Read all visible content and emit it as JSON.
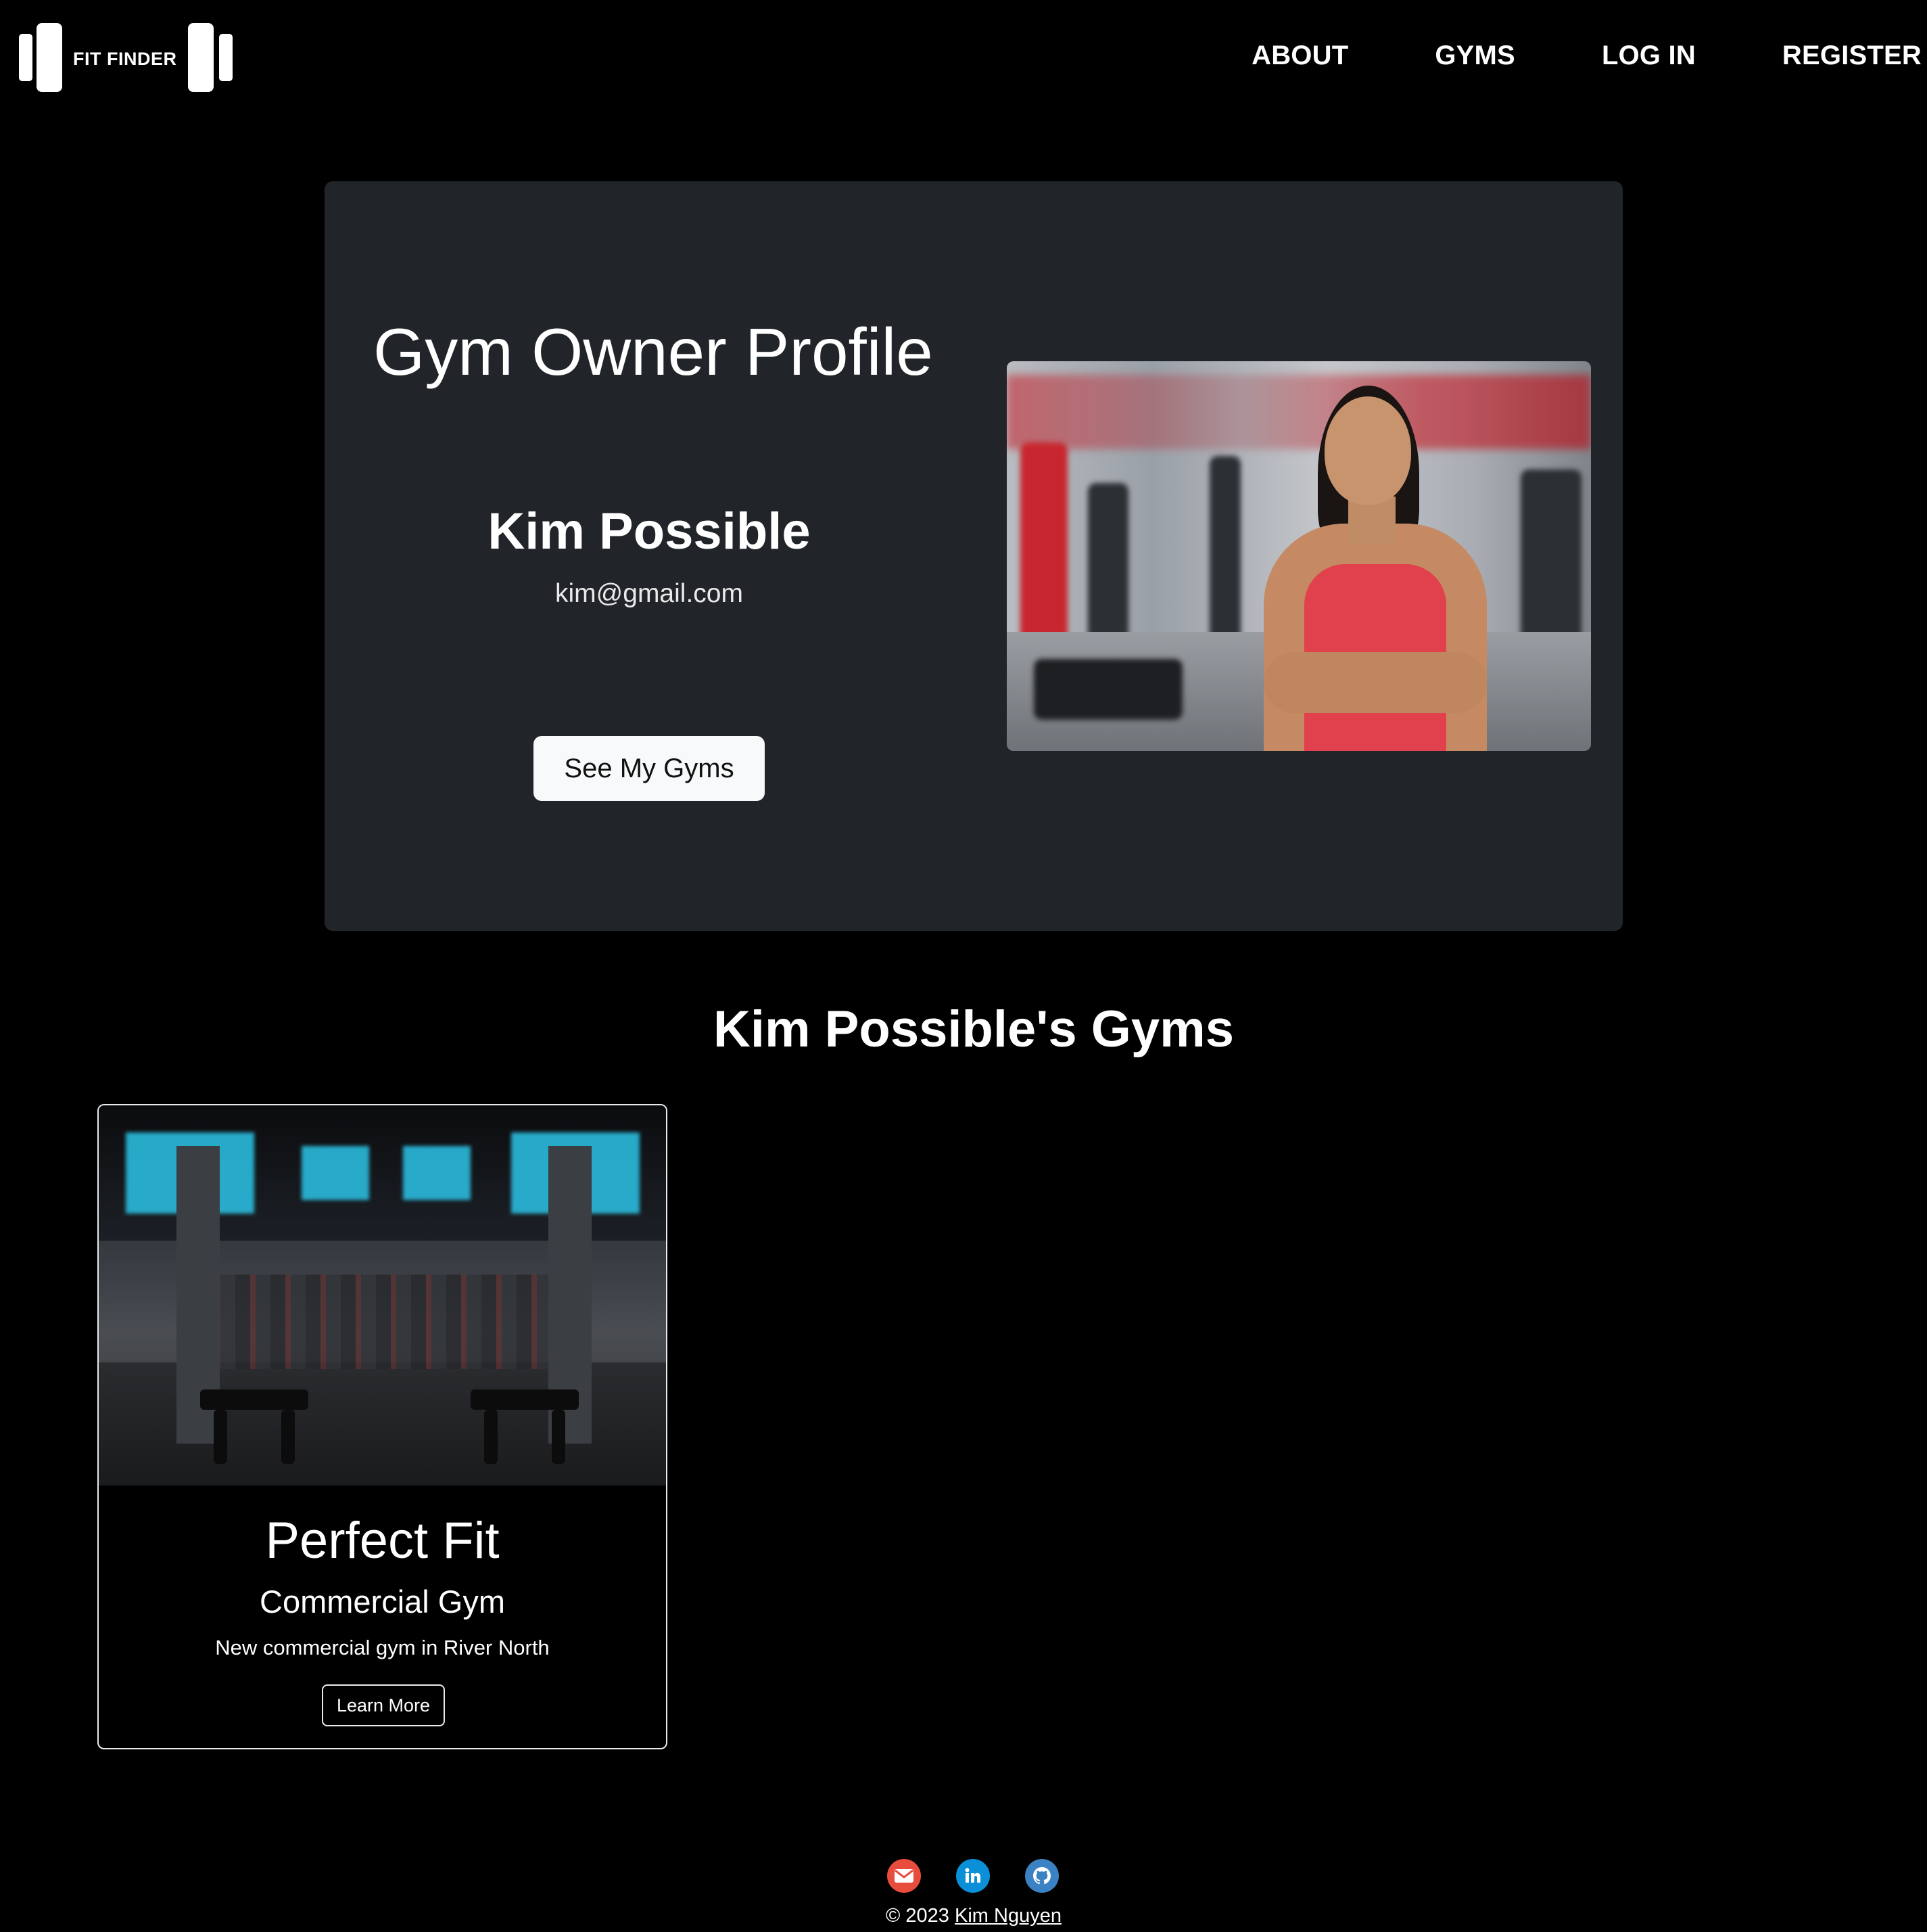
{
  "brand": {
    "name": "FIT FINDER"
  },
  "nav": {
    "links": [
      {
        "label": "ABOUT"
      },
      {
        "label": "GYMS"
      },
      {
        "label": "LOG IN"
      },
      {
        "label": "REGISTER"
      }
    ]
  },
  "profile": {
    "title": "Gym Owner Profile",
    "name": "Kim Possible",
    "email": "kim@gmail.com",
    "button_label": "See My Gyms"
  },
  "gyms_section": {
    "heading": "Kim Possible's Gyms",
    "gyms": [
      {
        "name": "Perfect Fit",
        "type": "Commercial Gym",
        "description": "New commercial gym in River North",
        "button_label": "Learn More"
      }
    ]
  },
  "footer": {
    "icons": [
      "email-icon",
      "linkedin-icon",
      "github-icon"
    ],
    "copyright": "© 2023",
    "author_link": "Kim Nguyen"
  },
  "colors": {
    "background": "#000000",
    "card": "#212529",
    "button_light": "#f8f9fa",
    "email_red": "#e84c3d",
    "linkedin_blue": "#0a8fd8",
    "github_blue": "#3b82c4"
  }
}
